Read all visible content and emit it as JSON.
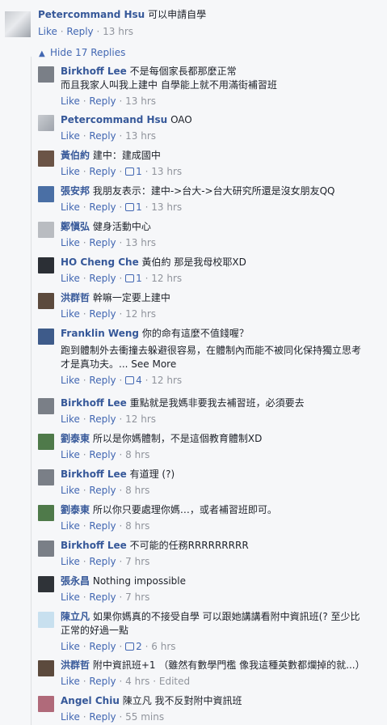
{
  "top_comment": {
    "name": "Petercommand Hsu",
    "text": "可以申請自學",
    "like": "Like",
    "reply": "Reply",
    "time": "13 hrs"
  },
  "hide_replies": "Hide 17 Replies",
  "replies": [
    {
      "name": "Birkhoff Lee",
      "text": "不是每個家長都那麼正常",
      "text2": "而且我家人叫我上建中 自學能上就不用滿街補習班",
      "time": "13 hrs",
      "likes": "",
      "edited": ""
    },
    {
      "name": "Petercommand Hsu",
      "text": "OAO",
      "time": "13 hrs",
      "likes": "",
      "edited": ""
    },
    {
      "name": "黃伯約",
      "text": "建中：建成國中",
      "time": "13 hrs",
      "likes": "1",
      "edited": ""
    },
    {
      "name": "張安邦",
      "text": "我朋友表示：建中->台大->台大研究所還是沒女朋友QQ",
      "time": "13 hrs",
      "likes": "1",
      "edited": ""
    },
    {
      "name": "鄭愼弘",
      "text": "健身活動中心",
      "time": "13 hrs",
      "likes": "",
      "edited": ""
    },
    {
      "name": "HO Cheng Che",
      "text": "黃伯約 那是我母校耶XD",
      "time": "12 hrs",
      "likes": "1",
      "edited": ""
    },
    {
      "name": "洪群哲",
      "text": "幹嘛一定要上建中",
      "time": "12 hrs",
      "likes": "",
      "edited": ""
    },
    {
      "name": "Franklin Weng",
      "text": "你的命有這麼不值錢喔？",
      "text2": "跑到體制外去衝撞去躲避很容易，在體制內而能不被同化保持獨立思考",
      "text3": "才是真功夫。...",
      "see_more": "See More",
      "time": "12 hrs",
      "likes": "4",
      "edited": ""
    },
    {
      "name": "Birkhoff Lee",
      "text": "重點就是我媽非要我去補習班，必須要去",
      "time": "12 hrs",
      "likes": "",
      "edited": ""
    },
    {
      "name": "劉泰東",
      "text": "所以是你媽體制，不是這個教育體制XD",
      "time": "8 hrs",
      "likes": "",
      "edited": ""
    },
    {
      "name": "Birkhoff Lee",
      "text": "有道理 (?)",
      "time": "8 hrs",
      "likes": "",
      "edited": ""
    },
    {
      "name": "劉泰東",
      "text": "所以你只要處理你媽…，或者補習班即可。",
      "time": "8 hrs",
      "likes": "",
      "edited": ""
    },
    {
      "name": "Birkhoff Lee",
      "text": "不可能的任務RRRRRRRRR",
      "time": "7 hrs",
      "likes": "",
      "edited": ""
    },
    {
      "name": "張永昌",
      "text": "Nothing impossible",
      "time": "7 hrs",
      "likes": "",
      "edited": ""
    },
    {
      "name": "陳立凡",
      "text": "如果你媽真的不接受自學 可以跟她講講看附中資訊班(? 至少比",
      "text2": "正常的好過一點",
      "time": "6 hrs",
      "likes": "2",
      "edited": ""
    },
    {
      "name": "洪群哲",
      "text": "附中資訊班+1 （雖然有數學門檻 像我這種英數都爛掉的就...）",
      "time": "4 hrs",
      "likes": "",
      "edited": "Edited"
    },
    {
      "name": "Angel Chiu",
      "text": "陳立凡 我不反對附中資訊班",
      "time": "55 mins",
      "likes": "",
      "edited": ""
    }
  ],
  "labels": {
    "like": "Like",
    "reply": "Reply",
    "dot": "·"
  },
  "colors": {
    "link": "#4267b2",
    "name": "#365899",
    "meta": "#90949c"
  }
}
